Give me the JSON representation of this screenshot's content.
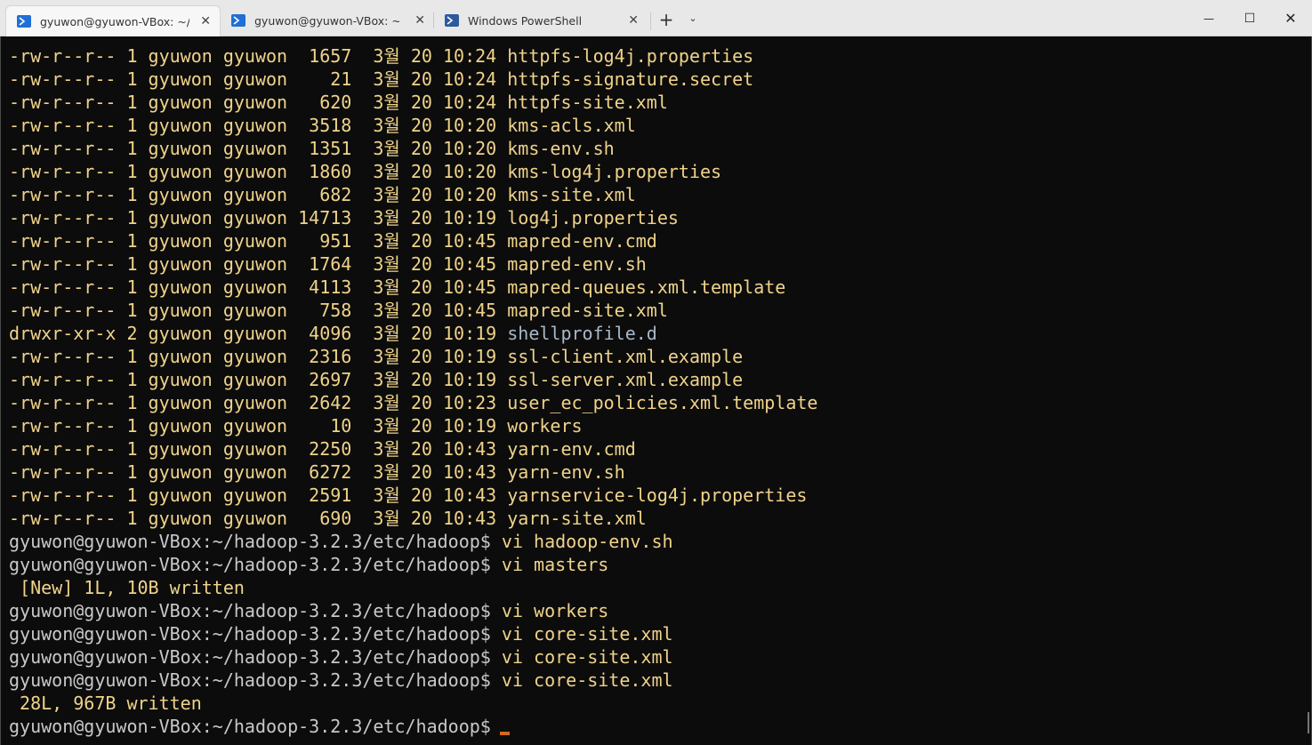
{
  "tabs": [
    {
      "title": "gyuwon@gyuwon-VBox: ~/h",
      "active": true,
      "close": "✕"
    },
    {
      "title": "gyuwon@gyuwon-VBox: ~/da",
      "active": false,
      "close": "✕"
    },
    {
      "title": "Windows PowerShell",
      "active": false,
      "close": "✕"
    }
  ],
  "newtab_label": "+",
  "dropdown_label": "⌄",
  "window_controls": {
    "minimize": "—",
    "maximize": "☐",
    "close": "✕"
  },
  "terminal": {
    "listing": [
      {
        "perm": "-rw-r--r--",
        "links": "1",
        "user": "gyuwon",
        "group": "gyuwon",
        "size": "1657",
        "month": "3월",
        "day": "20",
        "time": "10:24",
        "name": "httpfs-log4j.properties",
        "is_dir": false
      },
      {
        "perm": "-rw-r--r--",
        "links": "1",
        "user": "gyuwon",
        "group": "gyuwon",
        "size": "21",
        "month": "3월",
        "day": "20",
        "time": "10:24",
        "name": "httpfs-signature.secret",
        "is_dir": false
      },
      {
        "perm": "-rw-r--r--",
        "links": "1",
        "user": "gyuwon",
        "group": "gyuwon",
        "size": "620",
        "month": "3월",
        "day": "20",
        "time": "10:24",
        "name": "httpfs-site.xml",
        "is_dir": false
      },
      {
        "perm": "-rw-r--r--",
        "links": "1",
        "user": "gyuwon",
        "group": "gyuwon",
        "size": "3518",
        "month": "3월",
        "day": "20",
        "time": "10:20",
        "name": "kms-acls.xml",
        "is_dir": false
      },
      {
        "perm": "-rw-r--r--",
        "links": "1",
        "user": "gyuwon",
        "group": "gyuwon",
        "size": "1351",
        "month": "3월",
        "day": "20",
        "time": "10:20",
        "name": "kms-env.sh",
        "is_dir": false
      },
      {
        "perm": "-rw-r--r--",
        "links": "1",
        "user": "gyuwon",
        "group": "gyuwon",
        "size": "1860",
        "month": "3월",
        "day": "20",
        "time": "10:20",
        "name": "kms-log4j.properties",
        "is_dir": false
      },
      {
        "perm": "-rw-r--r--",
        "links": "1",
        "user": "gyuwon",
        "group": "gyuwon",
        "size": "682",
        "month": "3월",
        "day": "20",
        "time": "10:20",
        "name": "kms-site.xml",
        "is_dir": false
      },
      {
        "perm": "-rw-r--r--",
        "links": "1",
        "user": "gyuwon",
        "group": "gyuwon",
        "size": "14713",
        "month": "3월",
        "day": "20",
        "time": "10:19",
        "name": "log4j.properties",
        "is_dir": false
      },
      {
        "perm": "-rw-r--r--",
        "links": "1",
        "user": "gyuwon",
        "group": "gyuwon",
        "size": "951",
        "month": "3월",
        "day": "20",
        "time": "10:45",
        "name": "mapred-env.cmd",
        "is_dir": false
      },
      {
        "perm": "-rw-r--r--",
        "links": "1",
        "user": "gyuwon",
        "group": "gyuwon",
        "size": "1764",
        "month": "3월",
        "day": "20",
        "time": "10:45",
        "name": "mapred-env.sh",
        "is_dir": false
      },
      {
        "perm": "-rw-r--r--",
        "links": "1",
        "user": "gyuwon",
        "group": "gyuwon",
        "size": "4113",
        "month": "3월",
        "day": "20",
        "time": "10:45",
        "name": "mapred-queues.xml.template",
        "is_dir": false
      },
      {
        "perm": "-rw-r--r--",
        "links": "1",
        "user": "gyuwon",
        "group": "gyuwon",
        "size": "758",
        "month": "3월",
        "day": "20",
        "time": "10:45",
        "name": "mapred-site.xml",
        "is_dir": false
      },
      {
        "perm": "drwxr-xr-x",
        "links": "2",
        "user": "gyuwon",
        "group": "gyuwon",
        "size": "4096",
        "month": "3월",
        "day": "20",
        "time": "10:19",
        "name": "shellprofile.d",
        "is_dir": true
      },
      {
        "perm": "-rw-r--r--",
        "links": "1",
        "user": "gyuwon",
        "group": "gyuwon",
        "size": "2316",
        "month": "3월",
        "day": "20",
        "time": "10:19",
        "name": "ssl-client.xml.example",
        "is_dir": false
      },
      {
        "perm": "-rw-r--r--",
        "links": "1",
        "user": "gyuwon",
        "group": "gyuwon",
        "size": "2697",
        "month": "3월",
        "day": "20",
        "time": "10:19",
        "name": "ssl-server.xml.example",
        "is_dir": false
      },
      {
        "perm": "-rw-r--r--",
        "links": "1",
        "user": "gyuwon",
        "group": "gyuwon",
        "size": "2642",
        "month": "3월",
        "day": "20",
        "time": "10:23",
        "name": "user_ec_policies.xml.template",
        "is_dir": false
      },
      {
        "perm": "-rw-r--r--",
        "links": "1",
        "user": "gyuwon",
        "group": "gyuwon",
        "size": "10",
        "month": "3월",
        "day": "20",
        "time": "10:19",
        "name": "workers",
        "is_dir": false
      },
      {
        "perm": "-rw-r--r--",
        "links": "1",
        "user": "gyuwon",
        "group": "gyuwon",
        "size": "2250",
        "month": "3월",
        "day": "20",
        "time": "10:43",
        "name": "yarn-env.cmd",
        "is_dir": false
      },
      {
        "perm": "-rw-r--r--",
        "links": "1",
        "user": "gyuwon",
        "group": "gyuwon",
        "size": "6272",
        "month": "3월",
        "day": "20",
        "time": "10:43",
        "name": "yarn-env.sh",
        "is_dir": false
      },
      {
        "perm": "-rw-r--r--",
        "links": "1",
        "user": "gyuwon",
        "group": "gyuwon",
        "size": "2591",
        "month": "3월",
        "day": "20",
        "time": "10:43",
        "name": "yarnservice-log4j.properties",
        "is_dir": false
      },
      {
        "perm": "-rw-r--r--",
        "links": "1",
        "user": "gyuwon",
        "group": "gyuwon",
        "size": "690",
        "month": "3월",
        "day": "20",
        "time": "10:43",
        "name": "yarn-site.xml",
        "is_dir": false
      }
    ],
    "prompt": "gyuwon@gyuwon-VBox:~/hadoop-3.2.3/etc/hadoop$",
    "history": [
      {
        "type": "cmd",
        "text": "vi hadoop-env.sh"
      },
      {
        "type": "cmd",
        "text": "vi masters"
      },
      {
        "type": "out",
        "text": " [New] 1L, 10B written"
      },
      {
        "type": "cmd",
        "text": "vi workers"
      },
      {
        "type": "cmd",
        "text": "vi core-site.xml"
      },
      {
        "type": "cmd",
        "text": "vi core-site.xml"
      },
      {
        "type": "cmd",
        "text": "vi core-site.xml"
      },
      {
        "type": "out",
        "text": " 28L, 967B written"
      },
      {
        "type": "cmd",
        "text": ""
      }
    ],
    "colors": {
      "background": "#0c0c0c",
      "text": "#f0d38a",
      "directory": "#a8b8c8",
      "prompt": "#c8c8c8",
      "cursor": "#d2691e"
    }
  }
}
